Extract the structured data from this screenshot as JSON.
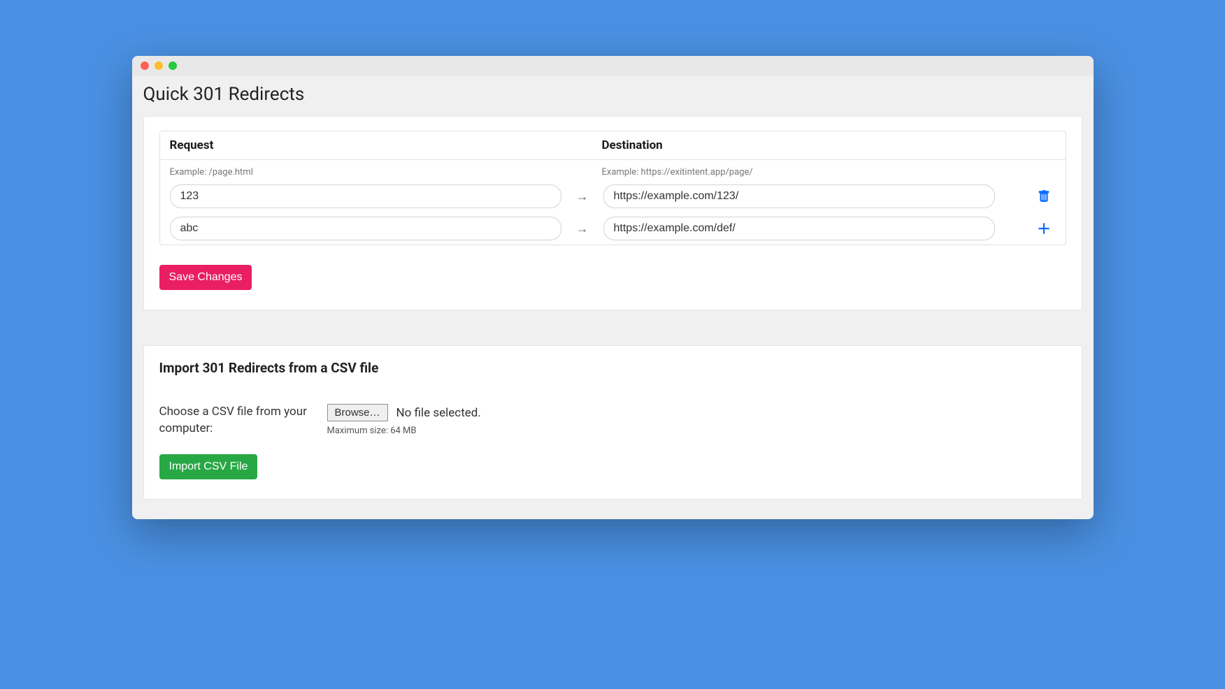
{
  "page_title": "Quick 301 Redirects",
  "redirects": {
    "columns": {
      "request": "Request",
      "destination": "Destination"
    },
    "examples": {
      "request": "Example: /page.html",
      "destination": "Example: https://exitintent.app/page/"
    },
    "rows": [
      {
        "request": "123",
        "destination": "https://example.com/123/",
        "action": "delete"
      },
      {
        "request": "abc",
        "destination": "https://example.com/def/",
        "action": "add"
      }
    ],
    "arrow": "→",
    "save_button": "Save Changes"
  },
  "import": {
    "title": "Import 301 Redirects from a CSV file",
    "choose_label": "Choose a CSV file from your computer:",
    "browse_button": "Browse…",
    "no_file_text": "No file selected.",
    "max_size": "Maximum size: 64 MB",
    "import_button": "Import CSV File"
  }
}
